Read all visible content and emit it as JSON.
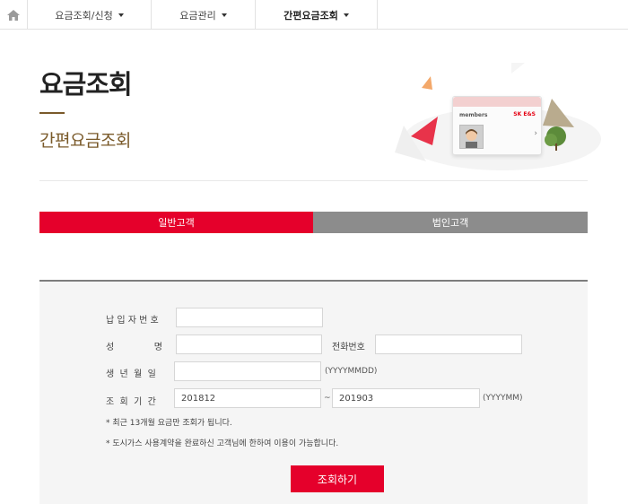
{
  "nav": {
    "home_icon": "home-icon",
    "items": [
      {
        "label": "요금조회/신청"
      },
      {
        "label": "요금관리"
      },
      {
        "label": "간편요금조회"
      }
    ]
  },
  "header": {
    "title": "요금조회",
    "subtitle": "간편요금조회"
  },
  "illustration": {
    "card_members": "members",
    "card_logo": "SK E&S"
  },
  "tabs": [
    {
      "label": "일반고객",
      "active": true
    },
    {
      "label": "법인고객",
      "active": false
    }
  ],
  "form": {
    "customer_no_label": "납 입 자 번 호",
    "customer_no_value": "",
    "name_label": "성              명",
    "name_value": "",
    "phone_label": "전화번호",
    "phone_value": "",
    "birth_label": "생  년  월  일",
    "birth_value": "",
    "birth_hint": "(YYYYMMDD)",
    "period_label": "조  회  기  간",
    "period_from": "201812",
    "period_sep": "~",
    "period_to": "201903",
    "period_hint": "(YYYYMM)",
    "note1": "* 최근 13개월 요금만 조회가 됩니다.",
    "note2": "* 도시가스 사용계약을 완료하신 고객님에 한하여 이용이 가능합니다.",
    "submit_label": "조회하기"
  },
  "colors": {
    "accent": "#e5002b",
    "brown": "#7a5a2a",
    "tab_inactive": "#8c8c8c"
  }
}
